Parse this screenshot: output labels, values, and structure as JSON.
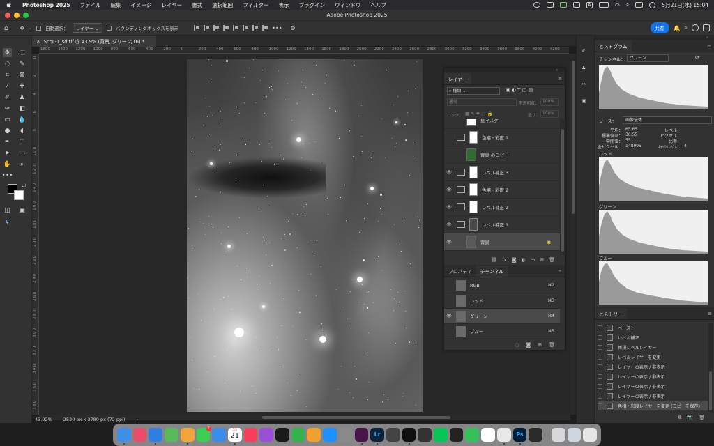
{
  "menubar": {
    "app_name": "Photoshop 2025",
    "items": [
      "ファイル",
      "編集",
      "イメージ",
      "レイヤー",
      "書式",
      "選択範囲",
      "フィルター",
      "表示",
      "プラグイン",
      "ウィンドウ",
      "ヘルプ"
    ],
    "clock": "5月21日(水) 15:04",
    "status_letter": "A"
  },
  "titlebar": {
    "title": "Adobe Photoshop 2025"
  },
  "options": {
    "auto_select_label": "自動選択：",
    "auto_select_value": "レイヤー",
    "bounding_box_label": "バウンディングボックスを表示",
    "more": "•••",
    "share_label": "共有"
  },
  "document": {
    "tab_title": "ScoL-1_sd.tif @ 43.9% (背景, グリーン/16) *",
    "close": "×"
  },
  "ruler_h": [
    "1600",
    "1400",
    "1200",
    "1000",
    "800",
    "600",
    "400",
    "200",
    "0",
    "200",
    "400",
    "600",
    "800",
    "1000",
    "1200",
    "1400",
    "1600",
    "1800",
    "2000",
    "2200",
    "2400",
    "2600",
    "2800",
    "3000",
    "3200",
    "3400",
    "3600",
    "3800",
    "4000",
    "4200"
  ],
  "ruler_v": [
    "0",
    "2",
    "4",
    "6",
    "8",
    "1 0 0",
    "1 2 0",
    "1 4 0",
    "1 6 0",
    "1 8 0",
    "2 0 0",
    "2 2 0",
    "2 4 0",
    "2 6 0",
    "2 8 0",
    "3 0 0",
    "3 2 0",
    "3 4 0",
    "3 6 0",
    "3 8 0"
  ],
  "status": {
    "zoom": "43.92%",
    "doc_size": "2520 px x 3780 px (72 ppi)",
    "arrow": "›"
  },
  "layers_panel": {
    "tab": "レイヤー",
    "kind_value": "種類",
    "blend_value": "通常",
    "opacity_label": "不透明度：",
    "opacity_value": "100%",
    "lock_label": "ロック：",
    "fill_label": "塗り：",
    "fill_value": "100%",
    "layers": [
      {
        "name": "星マスク",
        "visible": false,
        "type": "pixel"
      },
      {
        "name": "色相・彩度 1",
        "visible": false,
        "type": "adjust"
      },
      {
        "name": "背景 のコピー",
        "visible": false,
        "type": "pixel"
      },
      {
        "name": "レベル補正 3",
        "visible": true,
        "type": "levels"
      },
      {
        "name": "色相・彩度 2",
        "visible": true,
        "type": "adjust"
      },
      {
        "name": "レベル補正 2",
        "visible": true,
        "type": "levels"
      },
      {
        "name": "レベル補正 1",
        "visible": true,
        "type": "levels"
      },
      {
        "name": "背景",
        "visible": true,
        "type": "background"
      }
    ],
    "lock_glyph": "🔒"
  },
  "channels_panel": {
    "tabs": [
      "プロパティ",
      "チャンネル"
    ],
    "channels": [
      {
        "name": "RGB",
        "shortcut": "⌘2",
        "visible": false
      },
      {
        "name": "レッド",
        "shortcut": "⌘3",
        "visible": false
      },
      {
        "name": "グリーン",
        "shortcut": "⌘4",
        "visible": true
      },
      {
        "name": "ブルー",
        "shortcut": "⌘5",
        "visible": false
      }
    ]
  },
  "histogram_panel": {
    "title": "ヒストグラム",
    "channel_label": "チャンネル：",
    "channel_value": "グリーン",
    "source_label": "ソース：",
    "source_value": "画像全体",
    "stats": {
      "mean_label": "平均：",
      "mean": "65.65",
      "std_label": "標準偏差：",
      "std": "30.55",
      "median_label": "中間値：",
      "median": "55",
      "pixels_label": "全ピクセル：",
      "pixels": "148995",
      "level_label": "レベル：",
      "count_label": "ピクセル：",
      "percent_label": "比率：",
      "cache_label": "ｷｬｯｼｭﾚﾍﾞﾙ：",
      "cache": "4"
    },
    "channels": [
      "レッド",
      "グリーン",
      "ブルー"
    ]
  },
  "history_panel": {
    "title": "ヒストリー",
    "items": [
      "ペースト",
      "レベル補正",
      "新規レベルレイヤー",
      "レベルレイヤーを変更",
      "レイヤーの表示 / 非表示",
      "レイヤーの表示 / 非表示",
      "レイヤーの表示 / 非表示",
      "レイヤーの表示 / 非表示",
      "色相・彩度レイヤーを変更 (コピーを保存)"
    ]
  },
  "dock": {
    "calendar_day": "21",
    "calendar_month": "5月",
    "badge": "1",
    "apps": [
      {
        "name": "finder",
        "color": "#3d8fe8"
      },
      {
        "name": "launchpad",
        "color": "#e94b6a"
      },
      {
        "name": "safari",
        "color": "#2f7fe0"
      },
      {
        "name": "maps",
        "color": "#5cb85c"
      },
      {
        "name": "photos",
        "color": "#f2a53a"
      },
      {
        "name": "messages",
        "color": "#3ccf53"
      },
      {
        "name": "mail",
        "color": "#3b8ce8"
      },
      {
        "name": "calendar",
        "color": "#ffffff"
      },
      {
        "name": "music",
        "color": "#f43f5e"
      },
      {
        "name": "podcasts",
        "color": "#9b4fd6"
      },
      {
        "name": "tv",
        "color": "#1a1a1a"
      },
      {
        "name": "numbers",
        "color": "#33b24e"
      },
      {
        "name": "pages",
        "color": "#f0a030"
      },
      {
        "name": "appstore",
        "color": "#1d8fff"
      },
      {
        "name": "settings",
        "color": "#8a8a8a"
      },
      {
        "name": "slack",
        "color": "#4a154b"
      },
      {
        "name": "lightroom",
        "color": "#0c2338"
      },
      {
        "name": "photo-app",
        "color": "#444"
      },
      {
        "name": "terminal",
        "color": "#111"
      },
      {
        "name": "davinci",
        "color": "#333"
      },
      {
        "name": "line",
        "color": "#06c755"
      },
      {
        "name": "app-black",
        "color": "#222"
      },
      {
        "name": "facetime",
        "color": "#35c15a"
      },
      {
        "name": "notes",
        "color": "#fff"
      },
      {
        "name": "chrome",
        "color": "#e8e8e8"
      },
      {
        "name": "photoshop",
        "color": "#001e36"
      },
      {
        "name": "screenshot",
        "color": "#2a2a2a"
      },
      {
        "name": "preview",
        "color": "#d8d8d8"
      },
      {
        "name": "window-app",
        "color": "#cfd6e0"
      },
      {
        "name": "trash",
        "color": "#e6e6e6"
      }
    ],
    "lr_label": "Lr",
    "ps_label": "Ps"
  }
}
